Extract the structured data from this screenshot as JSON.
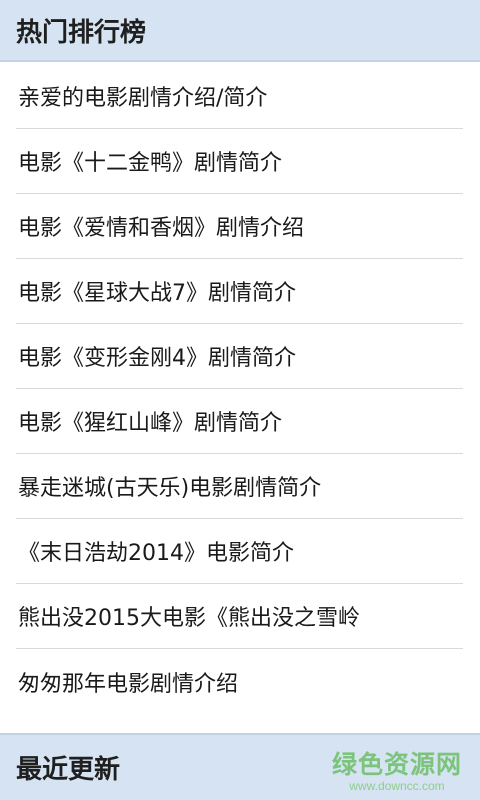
{
  "hot_section": {
    "title": "热门排行榜",
    "items": [
      {
        "label": "亲爱的电影剧情介绍/简介"
      },
      {
        "label": "电影《十二金鸭》剧情简介"
      },
      {
        "label": "电影《爱情和香烟》剧情介绍"
      },
      {
        "label": "电影《星球大战7》剧情简介"
      },
      {
        "label": "电影《变形金刚4》剧情简介"
      },
      {
        "label": "电影《猩红山峰》剧情简介"
      },
      {
        "label": "暴走迷城(古天乐)电影剧情简介"
      },
      {
        "label": "《末日浩劫2014》电影简介"
      },
      {
        "label": "熊出没2015大电影《熊出没之雪岭"
      },
      {
        "label": "匆匆那年电影剧情介绍"
      }
    ]
  },
  "recent_section": {
    "title": "最近更新"
  },
  "watermark": {
    "title": "绿色资源网",
    "url": "www.downcc.com"
  },
  "colors": {
    "header_bg": "#d5e3f2",
    "divider": "#d9d9d9",
    "watermark": "#73c16f"
  }
}
